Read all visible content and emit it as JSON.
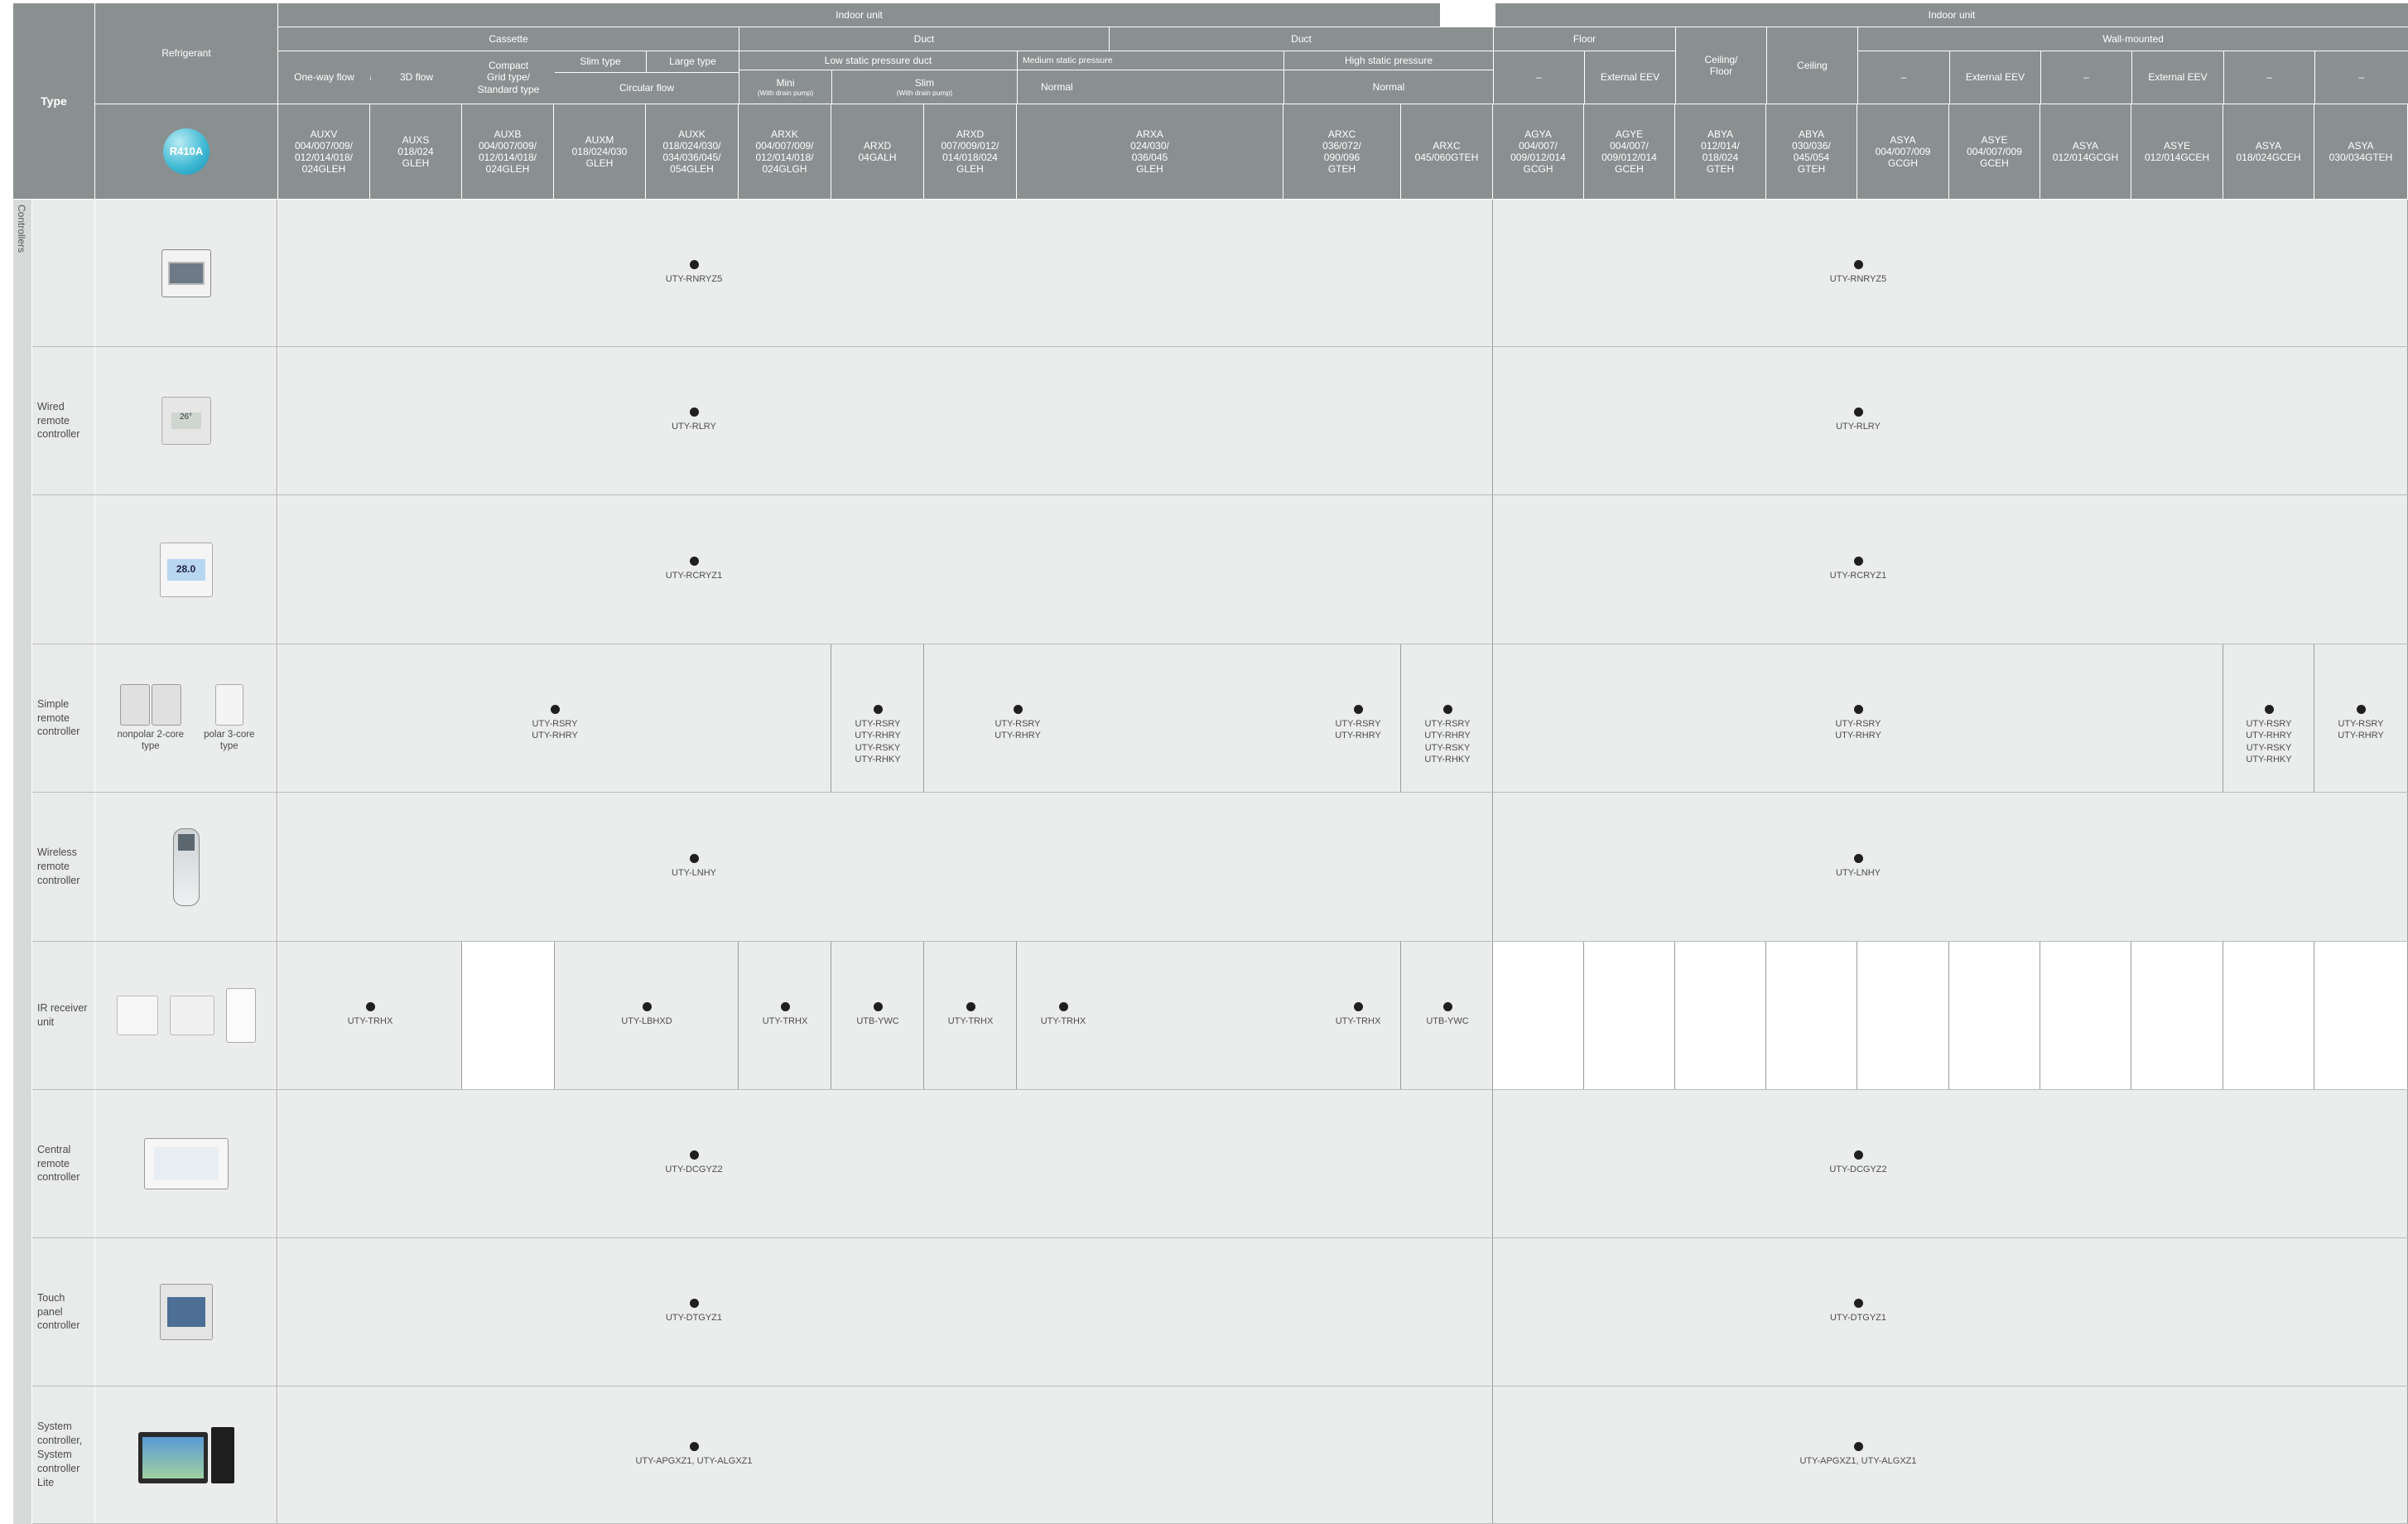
{
  "header": {
    "type_label": "Type",
    "refrigerant_label": "Refrigerant",
    "refrigerant_icon": "R410A",
    "indoor_unit_left": "Indoor unit",
    "indoor_unit_right": "Indoor unit",
    "groups": {
      "cassette": "Cassette",
      "duct_left": "Duct",
      "duct_right": "Duct",
      "floor": "Floor",
      "ceiling_floor": "Ceiling/\nFloor",
      "ceiling": "Ceiling",
      "wall_mounted": "Wall-mounted"
    },
    "subgroups": {
      "slim_type": "Slim type",
      "large_type": "Large type",
      "circular_flow": "Circular flow",
      "low_static": "Low static pressure duct",
      "medium_static": "Medium static pressure",
      "high_static": "High static pressure",
      "one_way": "One-way flow",
      "three_d": "3D flow",
      "compact": "Compact\nGrid type/\nStandard type",
      "mini": "Mini",
      "mini_sub": "(With drain pump)",
      "slim": "Slim",
      "slim_sub": "(With drain pump)",
      "normal_med": "Normal",
      "normal_high": "Normal",
      "floor_dash": "–",
      "floor_eev": "External EEV",
      "wall_dash1": "–",
      "wall_eev1": "External EEV",
      "wall_dash2": "–",
      "wall_eev2": "External  EEV",
      "wall_dash3": "–",
      "wall_dash4": "–"
    },
    "models": [
      "AUXV\n004/007/009/\n012/014/018/\n024GLEH",
      "AUXS\n018/024\nGLEH",
      "AUXB\n004/007/009/\n012/014/018/\n024GLEH",
      "AUXM\n018/024/030\nGLEH",
      "AUXK\n018/024/030/\n034/036/045/\n054GLEH",
      "ARXK\n004/007/009/\n012/014/018/\n024GLGH",
      "ARXD\n04GALH",
      "ARXD\n007/009/012/\n014/018/024\nGLEH",
      "ARXA\n024/030/\n036/045\nGLEH",
      "ARXC\n036/072/\n090/096\nGTEH",
      "ARXC\n045/060GTEH",
      "AGYA\n004/007/\n009/012/014\nGCGH",
      "AGYE\n004/007/\n009/012/014\nGCEH",
      "ABYA\n012/014/\n018/024\nGTEH",
      "ABYA\n030/036/\n045/054\nGTEH",
      "ASYA\n004/007/009\nGCGH",
      "ASYE\n004/007/009\nGCEH",
      "ASYA\n012/014GCGH",
      "ASYE\n012/014GCEH",
      "ASYA\n018/024GCEH",
      "ASYA\n030/034GTEH"
    ]
  },
  "side_label": "Controllers",
  "rows": [
    {
      "label": "",
      "icon": "wired-controller-rnryz5-icon",
      "cells": [
        "UTY-RNRYZ5",
        "UTY-RNRYZ5"
      ]
    },
    {
      "label": "Wired\nremote\ncontroller",
      "icon": "wired-controller-rlry-icon",
      "cells": [
        "UTY-RLRY",
        "UTY-RLRY"
      ]
    },
    {
      "label": "",
      "icon": "wired-controller-rcryz1-icon",
      "cells": [
        "UTY-RCRYZ1",
        "UTY-RCRYZ1"
      ]
    },
    {
      "label": "Simple\nremote\ncontroller",
      "icon": "simple-remote-controllers-icon",
      "icon_captions": [
        "nonpolar 2-core\ntype",
        "polar 3-core\ntype"
      ],
      "cells": [
        "UTY-RSRY\nUTY-RHRY",
        "UTY-RSRY\nUTY-RHRY\nUTY-RSKY\nUTY-RHKY",
        "UTY-RSRY\nUTY-RHRY",
        "UTY-RSRY\nUTY-RHRY",
        "UTY-RSRY\nUTY-RHRY\nUTY-RSKY\nUTY-RHKY",
        "UTY-RSRY\nUTY-RHRY",
        "UTY-RSRY\nUTY-RHRY\nUTY-RSKY\nUTY-RHKY",
        "UTY-RSRY\nUTY-RHRY"
      ]
    },
    {
      "label": "Wireless\nremote\ncontroller",
      "icon": "wireless-remote-icon",
      "cells": [
        "UTY-LNHY",
        "UTY-LNHY"
      ]
    },
    {
      "label": "IR receiver\nunit",
      "icon": "ir-receiver-units-icon",
      "cells": [
        "UTY-TRHX",
        "UTY-LBHXD",
        "UTY-TRHX",
        "UTB-YWC",
        "UTY-TRHX",
        "UTY-TRHX",
        "UTY-TRHX",
        "UTB-YWC"
      ]
    },
    {
      "label": "Central\nremote\ncontroller",
      "icon": "central-remote-icon",
      "cells": [
        "UTY-DCGYZ2",
        "UTY-DCGYZ2"
      ]
    },
    {
      "label": "Touch\npanel\ncontroller",
      "icon": "touch-panel-icon",
      "cells": [
        "UTY-DTGYZ1",
        "UTY-DTGYZ1"
      ]
    },
    {
      "label": "System\ncontroller,\nSystem\ncontroller\nLite",
      "icon": "system-controller-pc-icon",
      "cells": [
        "UTY-APGXZ1, UTY-ALGXZ1",
        "UTY-APGXZ1, UTY-ALGXZ1"
      ]
    }
  ],
  "colors": {
    "header_bg": "#8a8f90",
    "row_bg": "#ebecec",
    "grid": "#b9bcbd",
    "dot": "#1f1f1f"
  }
}
